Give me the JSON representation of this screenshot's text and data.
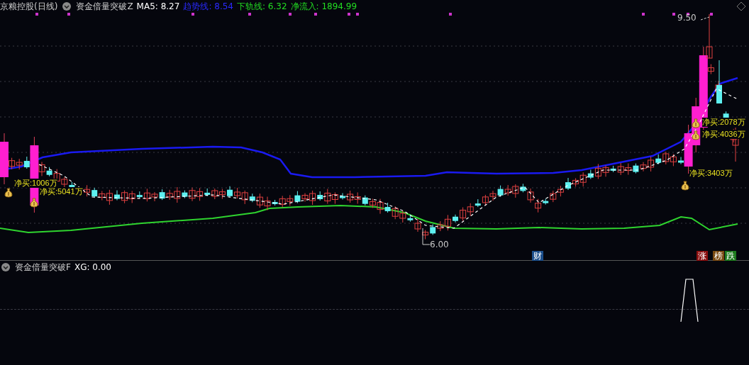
{
  "header": {
    "stock": "京粮控股(日线)",
    "indicator": "资金倍量突破Z",
    "values": [
      {
        "text": "MA5: 8.27",
        "color": "#ffffff"
      },
      {
        "text": "趋势线: 8.54",
        "color": "#2a2aff"
      },
      {
        "text": "下轨线: 6.32",
        "color": "#22dd22"
      },
      {
        "text": "净流入: 1894.99",
        "color": "#22dd22"
      }
    ]
  },
  "annotations": [
    {
      "text": "净买:2078万"
    },
    {
      "text": "净买:4036万"
    },
    {
      "text": "净买:3403万"
    },
    {
      "text": "净买:1006万"
    },
    {
      "text": "净买:5041万"
    }
  ],
  "price_labels": [
    "9.50",
    "6.00"
  ],
  "badges": [
    {
      "text": "财",
      "color": "#1c4f8c"
    },
    {
      "text": "涨",
      "color": "#8a0f0f"
    },
    {
      "text": "榜",
      "color": "#7a4a12"
    },
    {
      "text": "跌",
      "color": "#1d7a1d"
    }
  ],
  "sub_panel": {
    "indicator": "资金倍量突破F",
    "value": "XG: 0.00"
  }
}
